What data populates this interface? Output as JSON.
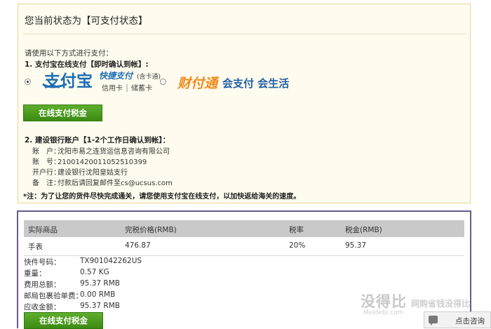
{
  "status": {
    "title": "您当前状态为【可支付状态】",
    "intro": "请使用以下方式进行支付：",
    "option1_title": "1. 支付宝在线支付【即时确认到帐】:",
    "alipay": {
      "name": "支付宝",
      "fast": "快捷支付",
      "sub1": "信用卡",
      "sub2": "储蓄卡",
      "note": "(含卡通)",
      "selected": true
    },
    "tenpay": {
      "name": "财付通",
      "slogan": "会支付 会生活",
      "selected": false
    },
    "pay_button": "在线支付税金",
    "option2_title": "2. 建设银行账户【1-2个工作日确认到帐】：",
    "bank": {
      "account_label": "账　户：",
      "account_value": "沈阳市易之连货运信息咨询有限公司",
      "number_label": "账　号：",
      "number_value": "21001420011052510399",
      "bank_label": "开户行：",
      "bank_value": "建设银行沈阳皇姑支行",
      "memo_label": "备　注：",
      "memo_value": "付款后请回复邮件至cs@ucsus.com"
    },
    "note": "*注：为了让您的货件尽快完成通关，请您使用支付宝在线支付，以加快返给海关的速度。"
  },
  "order": {
    "headers": [
      "实际商品",
      "完税价格(RMB)",
      "税率",
      "税金(RMB)"
    ],
    "row": [
      "手表",
      "476.87",
      "20%",
      "95.37"
    ],
    "info": [
      {
        "label": "快件号码：",
        "value": "TX901042262US"
      },
      {
        "label": "重量：",
        "value": "0.57 KG"
      },
      {
        "label": "费用总额：",
        "value": "95.37 RMB"
      },
      {
        "label": "邮局包裹验单费：",
        "value": "0.00 RMB"
      },
      {
        "label": "应收金额：",
        "value": "95.37 RMB"
      }
    ],
    "pay_button": "在线支付税金"
  },
  "watermark": {
    "brand": "没得比",
    "domain": "Meidebi.com",
    "slogan": "网购省钱没得比"
  },
  "consult": {
    "label": "点击咨询"
  },
  "colors": {
    "panel_bg": "#fffbee",
    "panel_border": "#e8d49b",
    "button": "#3b8a12",
    "order_border": "#6a5a8e",
    "alipay_blue": "#1d6eb3",
    "tenpay_orange": "#f08a1c"
  }
}
